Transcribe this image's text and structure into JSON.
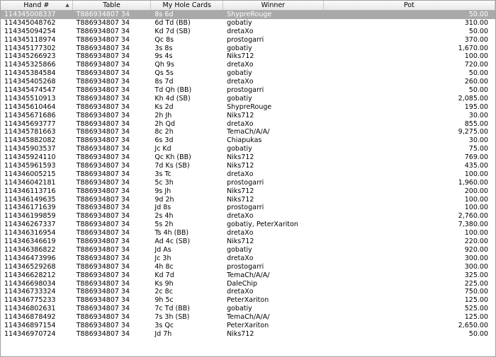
{
  "columns": {
    "hand": "Hand #",
    "table": "Table",
    "cards": "My Hole Cards",
    "winner": "Winner",
    "pot": "Pot"
  },
  "sort_icon": "sort-ascending-icon",
  "selected_row_color": "#a9a9a9",
  "rows": [
    {
      "hand": "114345008337",
      "table": "T886934807 34",
      "cards": "8s 6d",
      "winner": "ShypreRouge",
      "pot": "50.00"
    },
    {
      "hand": "114345048762",
      "table": "T886934807 34",
      "cards": "6d Td (BB)",
      "winner": "gobatiy",
      "pot": "310.00"
    },
    {
      "hand": "114345094254",
      "table": "T886934807 34",
      "cards": "Kd 7d (SB)",
      "winner": "dretaXo",
      "pot": "50.00"
    },
    {
      "hand": "114345118974",
      "table": "T886934807 34",
      "cards": "Qc 8s",
      "winner": "prostogarri",
      "pot": "370.00"
    },
    {
      "hand": "114345177302",
      "table": "T886934807 34",
      "cards": "3s 8s",
      "winner": "gobatiy",
      "pot": "1,670.00"
    },
    {
      "hand": "114345266923",
      "table": "T886934807 34",
      "cards": "9s 4s",
      "winner": "Niks712",
      "pot": "100.00"
    },
    {
      "hand": "114345325866",
      "table": "T886934807 34",
      "cards": "Qh 9s",
      "winner": "dretaXo",
      "pot": "720.00"
    },
    {
      "hand": "114345384584",
      "table": "T886934807 34",
      "cards": "Qs 5s",
      "winner": "gobatiy",
      "pot": "50.00"
    },
    {
      "hand": "114345405268",
      "table": "T886934807 34",
      "cards": "8s 7d",
      "winner": "dretaXo",
      "pot": "260.00"
    },
    {
      "hand": "114345474547",
      "table": "T886934807 34",
      "cards": "Td Qh (BB)",
      "winner": "prostogarri",
      "pot": "50.00"
    },
    {
      "hand": "114345510913",
      "table": "T886934807 34",
      "cards": "Kh 4d (SB)",
      "winner": "gobatiy",
      "pot": "2,085.00"
    },
    {
      "hand": "114345610464",
      "table": "T886934807 34",
      "cards": "Ks 2d",
      "winner": "ShypreRouge",
      "pot": "195.00"
    },
    {
      "hand": "114345671686",
      "table": "T886934807 34",
      "cards": "2h Jh",
      "winner": "Niks712",
      "pot": "30.00"
    },
    {
      "hand": "114345693777",
      "table": "T886934807 34",
      "cards": "2h Qd",
      "winner": "dretaXo",
      "pot": "855.00"
    },
    {
      "hand": "114345781663",
      "table": "T886934807 34",
      "cards": "8c 2h",
      "winner": "TemaCh/A/A/",
      "pot": "9,275.00"
    },
    {
      "hand": "114345882082",
      "table": "T886934807 34",
      "cards": "6s 3d",
      "winner": "Chiapukas",
      "pot": "30.00"
    },
    {
      "hand": "114345903537",
      "table": "T886934807 34",
      "cards": "Jc Kd",
      "winner": "gobatiy",
      "pot": "75.00"
    },
    {
      "hand": "114345924110",
      "table": "T886934807 34",
      "cards": "Qc Kh (BB)",
      "winner": "Niks712",
      "pot": "769.00"
    },
    {
      "hand": "114345961593",
      "table": "T886934807 34",
      "cards": "7d Ks (SB)",
      "winner": "Niks712",
      "pot": "435.00"
    },
    {
      "hand": "114346005215",
      "table": "T886934807 34",
      "cards": "3s Tc",
      "winner": "dretaXo",
      "pot": "100.00"
    },
    {
      "hand": "114346042181",
      "table": "T886934807 34",
      "cards": "5c 3h",
      "winner": "prostogarri",
      "pot": "1,960.00"
    },
    {
      "hand": "114346113716",
      "table": "T886934807 34",
      "cards": "9s Jh",
      "winner": "Niks712",
      "pot": "200.00"
    },
    {
      "hand": "114346149635",
      "table": "T886934807 34",
      "cards": "9d 2h",
      "winner": "Niks712",
      "pot": "100.00"
    },
    {
      "hand": "114346171639",
      "table": "T886934807 34",
      "cards": "Jd 8s",
      "winner": "prostogarri",
      "pot": "100.00"
    },
    {
      "hand": "114346199859",
      "table": "T886934807 34",
      "cards": "2s 4h",
      "winner": "dretaXo",
      "pot": "2,760.00"
    },
    {
      "hand": "114346267337",
      "table": "T886934807 34",
      "cards": "5s 2h",
      "winner": "gobatiy, PeterXariton",
      "pot": "7,380.00"
    },
    {
      "hand": "114346316954",
      "table": "T886934807 34",
      "cards": "Ts 4h (BB)",
      "winner": "dretaXo",
      "pot": "100.00"
    },
    {
      "hand": "114346346619",
      "table": "T886934807 34",
      "cards": "Ad 4c (SB)",
      "winner": "Niks712",
      "pot": "220.00"
    },
    {
      "hand": "114346386822",
      "table": "T886934807 34",
      "cards": "Jd As",
      "winner": "gobatiy",
      "pot": "920.00"
    },
    {
      "hand": "114346473996",
      "table": "T886934807 34",
      "cards": "Jc 3h",
      "winner": "dretaXo",
      "pot": "300.00"
    },
    {
      "hand": "114346529268",
      "table": "T886934807 34",
      "cards": "4h 8c",
      "winner": "prostogarri",
      "pot": "300.00"
    },
    {
      "hand": "114346628212",
      "table": "T886934807 34",
      "cards": "Kd 7d",
      "winner": "TemaCh/A/A/",
      "pot": "325.00"
    },
    {
      "hand": "114346698034",
      "table": "T886934807 34",
      "cards": "Ks 9h",
      "winner": "DaleChip",
      "pot": "225.00"
    },
    {
      "hand": "114346733324",
      "table": "T886934807 34",
      "cards": "2c 8c",
      "winner": "dretaXo",
      "pot": "750.00"
    },
    {
      "hand": "114346775233",
      "table": "T886934807 34",
      "cards": "9h 5c",
      "winner": "PeterXariton",
      "pot": "125.00"
    },
    {
      "hand": "114346802631",
      "table": "T886934807 34",
      "cards": "7c Td (BB)",
      "winner": "gobatiy",
      "pot": "525.00"
    },
    {
      "hand": "114346878492",
      "table": "T886934807 34",
      "cards": "7s 3h (SB)",
      "winner": "TemaCh/A/A/",
      "pot": "125.00"
    },
    {
      "hand": "114346897154",
      "table": "T886934807 34",
      "cards": "3s Qc",
      "winner": "PeterXariton",
      "pot": "2,650.00"
    },
    {
      "hand": "114346970724",
      "table": "T886934807 34",
      "cards": "Jd 7h",
      "winner": "Niks712",
      "pot": "50.00"
    }
  ]
}
